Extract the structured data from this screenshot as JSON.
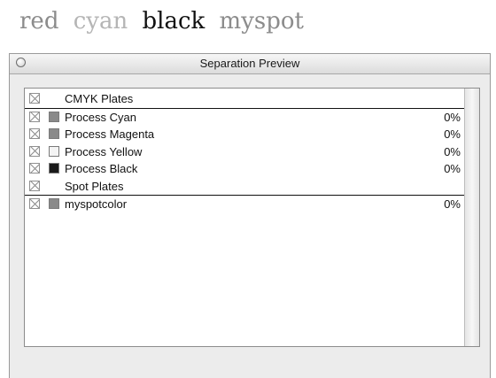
{
  "heading_words": [
    "red",
    "cyan",
    "black",
    "myspot"
  ],
  "window": {
    "title": "Separation Preview"
  },
  "plates": [
    {
      "label": "CMYK Plates",
      "type": "header"
    },
    {
      "label": "Process Cyan",
      "value": "0%",
      "swatch": "#8a8a8a"
    },
    {
      "label": "Process Magenta",
      "value": "0%",
      "swatch": "#8a8a8a"
    },
    {
      "label": "Process Yellow",
      "value": "0%",
      "swatch": "#f4f4f4"
    },
    {
      "label": "Process Black",
      "value": "0%",
      "swatch": "#1a1a1a"
    },
    {
      "label": "Spot Plates",
      "type": "header"
    },
    {
      "label": "myspotcolor",
      "value": "0%",
      "swatch": "#8a8a8a"
    }
  ]
}
